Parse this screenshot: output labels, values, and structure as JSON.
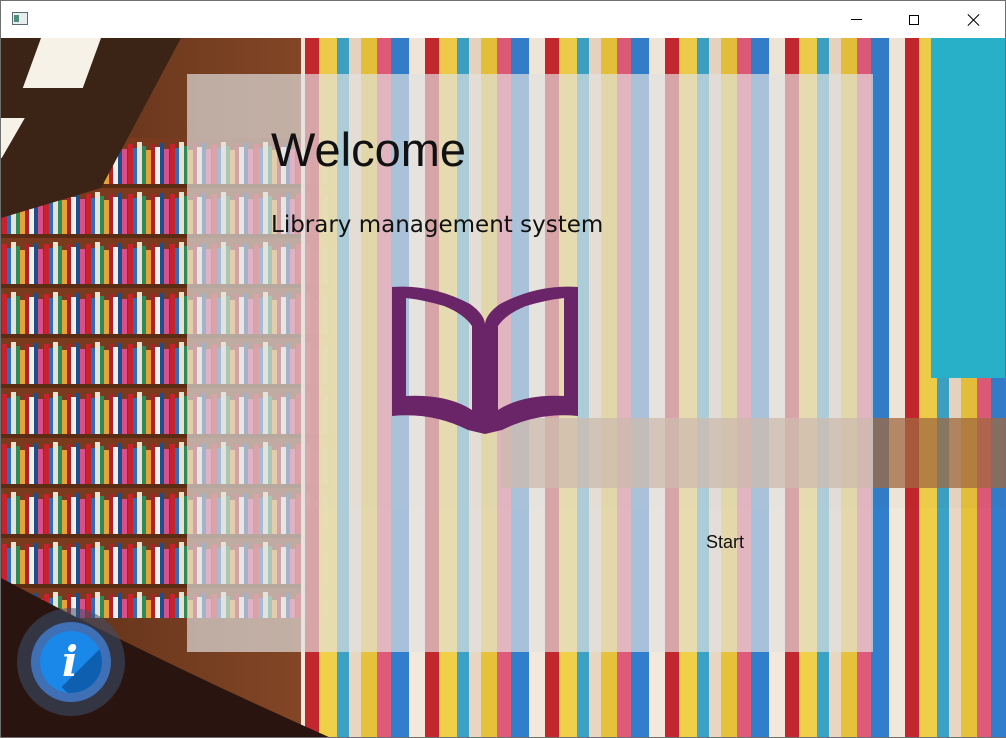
{
  "window": {
    "title": "",
    "app_icon": "app-window-icon",
    "controls": {
      "minimize_icon": "minimize-icon",
      "maximize_icon": "maximize-icon",
      "close_icon": "close-icon"
    }
  },
  "background": {
    "description_icon": "library-bookshelves-photo"
  },
  "panel": {
    "heading": "Welcome",
    "subtitle": "Library management system",
    "icon": "open-book-icon",
    "icon_color": "#6a2468",
    "start_label": "Start"
  },
  "info": {
    "icon": "info-icon",
    "glyph": "i",
    "accent_color": "#1a88e8"
  }
}
